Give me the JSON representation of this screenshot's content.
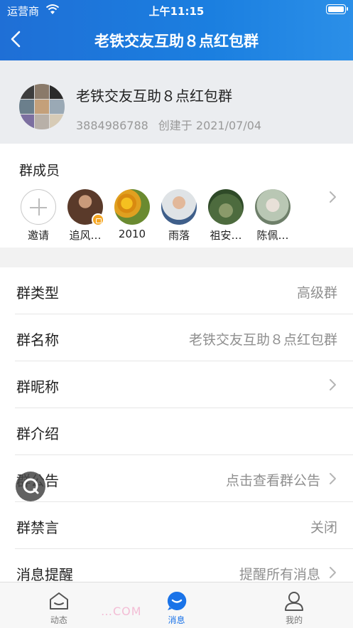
{
  "status_bar": {
    "carrier": "运营商",
    "time": "上午11:15"
  },
  "nav": {
    "title": "老铁交友互助８点红包群"
  },
  "group": {
    "name": "老铁交友互助８点红包群",
    "id": "3884986788",
    "created": "创建于 2021/07/04"
  },
  "members": {
    "heading": "群成员",
    "items": [
      {
        "name": "邀请",
        "color": "#ffffff"
      },
      {
        "name": "追风…",
        "color": "#5a3a2a"
      },
      {
        "name": "2010",
        "color": "#e0a020"
      },
      {
        "name": "雨落",
        "color": "#c9b8a8"
      },
      {
        "name": "祖安…",
        "color": "#4d6b3e"
      },
      {
        "name": "陈佩…",
        "color": "#b9c7b4"
      }
    ]
  },
  "settings": [
    {
      "label": "群类型",
      "value": "高级群",
      "chevron": false
    },
    {
      "label": "群名称",
      "value": "老铁交友互助８点红包群",
      "chevron": false
    },
    {
      "label": "群昵称",
      "value": "",
      "chevron": true
    },
    {
      "label": "群介绍",
      "value": "",
      "chevron": false
    },
    {
      "label": "群公告",
      "value": "点击查看群公告",
      "chevron": true
    },
    {
      "label": "群禁言",
      "value": "关闭",
      "chevron": false
    },
    {
      "label": "消息提醒",
      "value": "提醒所有消息",
      "chevron": true
    }
  ],
  "tabs": [
    {
      "label": "动态",
      "icon": "home-icon",
      "active": false
    },
    {
      "label": "消息",
      "icon": "message-icon",
      "active": true
    },
    {
      "label": "我的",
      "icon": "profile-icon",
      "active": false
    }
  ],
  "watermark": "…COM",
  "colors": {
    "accent": "#1a73e8",
    "header": "#1f6fd6"
  }
}
